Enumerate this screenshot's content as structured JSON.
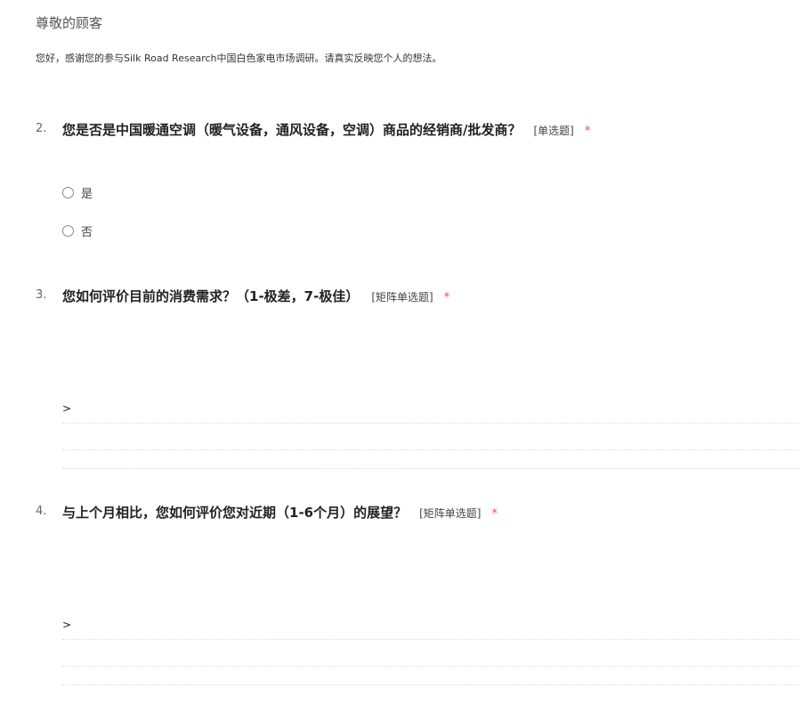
{
  "header": {
    "greeting": "尊敬的顾客",
    "intro": "您好，感谢您的参与Silk Road Research中国白色家电市场调研。请真实反映您个人的想法。"
  },
  "questions": [
    {
      "number": "2.",
      "title": "您是否是中国暖通空调（暖气设备，通风设备，空调）商品的经销商/批发商？",
      "type": "[单选题]",
      "required": "*",
      "options": [
        {
          "label": "是"
        },
        {
          "label": "否"
        }
      ]
    },
    {
      "number": "3.",
      "title": "您如何评价目前的消费需求？（1-极差，7-极佳）",
      "type": "[矩阵单选题]",
      "required": "*",
      "toggle": ">"
    },
    {
      "number": "4.",
      "title": "与上个月相比，您如何评价您对近期（1-6个月）的展望？",
      "type": "[矩阵单选题]",
      "required": "*",
      "toggle": ">"
    }
  ]
}
